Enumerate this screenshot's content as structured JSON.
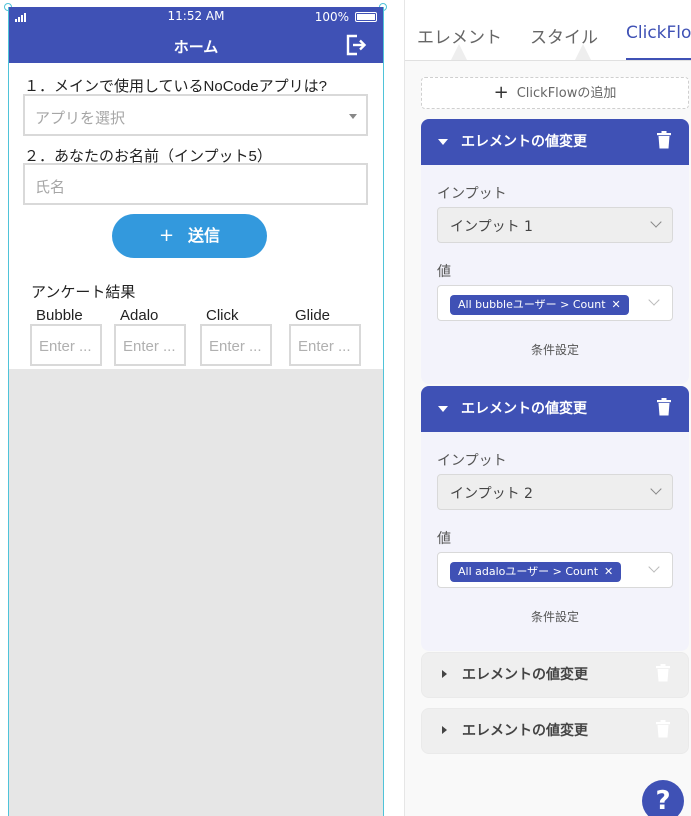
{
  "phone": {
    "status": {
      "time": "11:52 AM",
      "battery": "100%"
    },
    "title": "ホーム",
    "q1": {
      "label": "１．メインで使用しているNoCodeアプリは?",
      "placeholder": "アプリを選択"
    },
    "q2": {
      "label": "２．あなたのお名前（インプット5）",
      "placeholder": "氏名"
    },
    "submit_label": "送信",
    "results_title": "アンケート結果",
    "results": [
      {
        "label": "Bubble",
        "placeholder": "Enter ..."
      },
      {
        "label": "Adalo",
        "placeholder": "Enter ..."
      },
      {
        "label": "Click",
        "placeholder": "Enter ..."
      },
      {
        "label": "Glide",
        "placeholder": "Enter ..."
      }
    ]
  },
  "panel": {
    "tabs": [
      "エレメント",
      "スタイル",
      "ClickFlow"
    ],
    "active_tab": "ClickFlow",
    "add_flow_label": "ClickFlowの追加",
    "cards": [
      {
        "title": "エレメントの値変更",
        "input_label": "インプット",
        "input_value": "インプット 1",
        "value_label": "値",
        "value_chip": "All bubbleユーザー > Count",
        "condition_label": "条件設定"
      },
      {
        "title": "エレメントの値変更",
        "input_label": "インプット",
        "input_value": "インプット 2",
        "value_label": "値",
        "value_chip": "All adaloユーザー > Count",
        "condition_label": "条件設定"
      },
      {
        "title": "エレメントの値変更"
      },
      {
        "title": "エレメントの値変更"
      }
    ],
    "help_label": "?"
  },
  "icons": [
    "signal-icon",
    "battery-icon",
    "logout-icon",
    "plus-icon",
    "caret-down-icon",
    "caret-right-icon",
    "trash-icon",
    "chevron-down-icon",
    "close-icon",
    "help-icon"
  ],
  "colors": {
    "primary": "#3f51b5",
    "submit": "#3399dd",
    "accent_outline": "#4fc3d9"
  }
}
